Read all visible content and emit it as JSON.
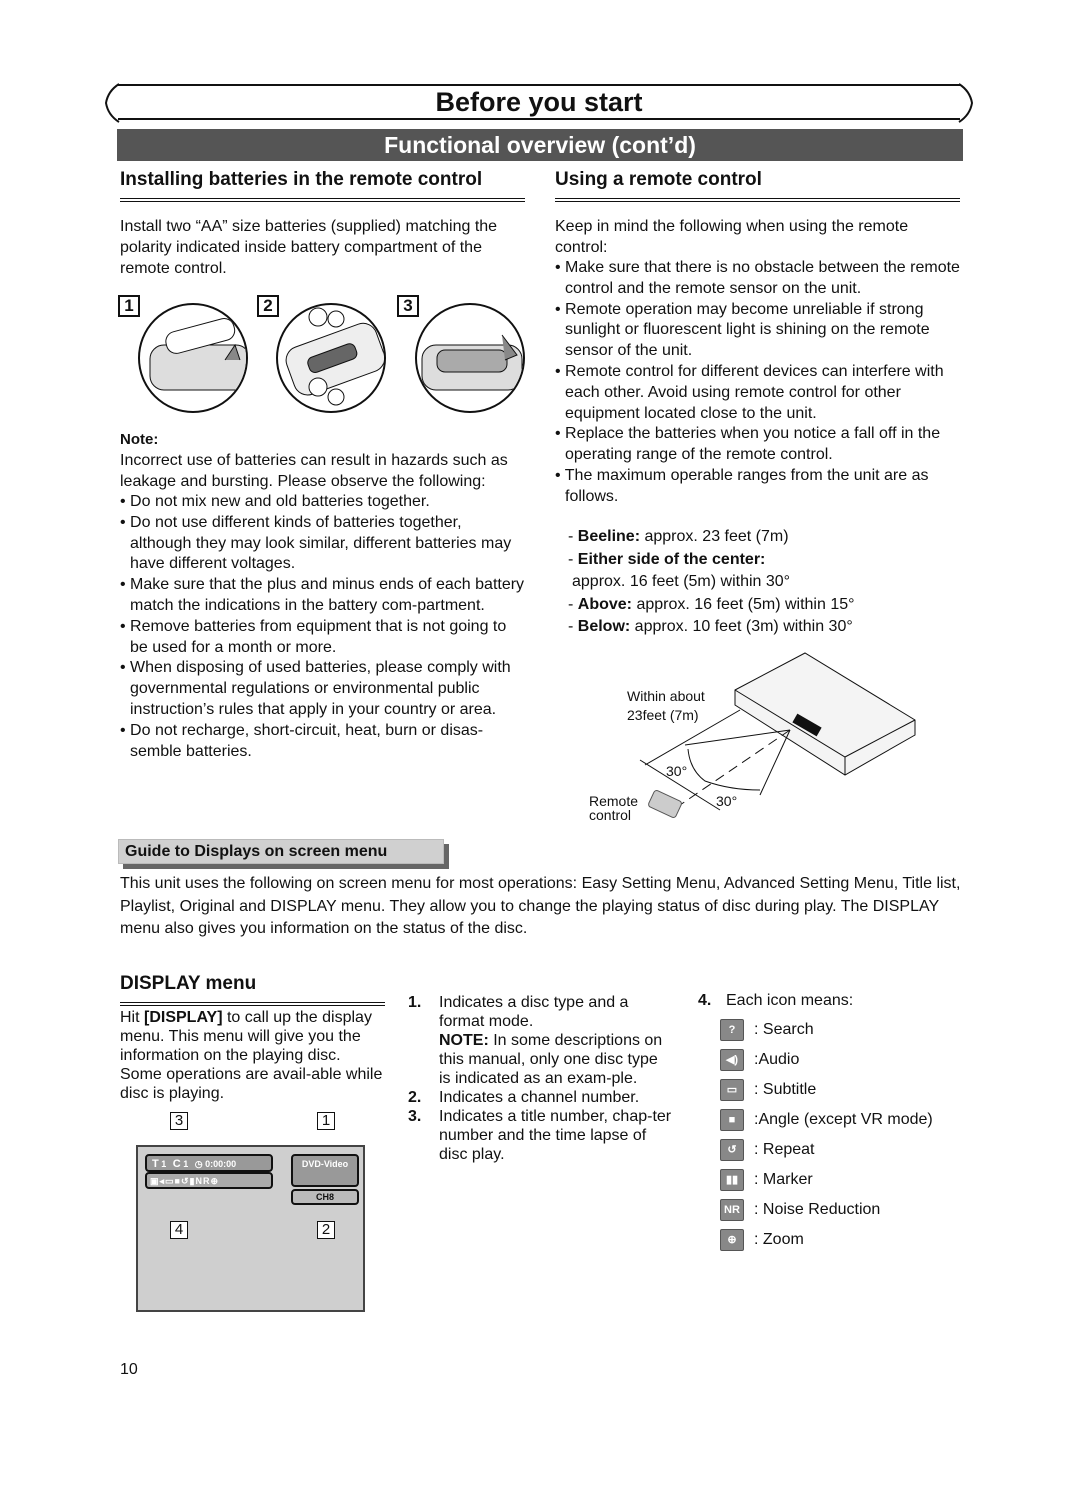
{
  "header": {
    "title": "Before you start",
    "subtitle": "Functional overview (cont’d)"
  },
  "batteries": {
    "heading": "Installing batteries in the remote control",
    "intro": "Install two “AA” size batteries (supplied) matching the polarity indicated inside battery compartment of the remote control.",
    "steps": [
      "1",
      "2",
      "3"
    ],
    "note_label": "Note:",
    "note_text": "Incorrect use of batteries can result in hazards such as leakage and bursting. Please observe the following:",
    "bullets": [
      "Do not mix new and old batteries together.",
      "Do not use different kinds of batteries together, although they may look similar, different batteries may have different voltages.",
      "Make sure that the plus and minus ends of each battery match the indications in the battery com-partment.",
      "Remove batteries from equipment that is not going to be used for a month or more.",
      "When disposing of used batteries, please comply with governmental regulations or environmental public instruction’s rules that apply in your country or area.",
      "Do not recharge, short-circuit, heat, burn or disas-semble batteries."
    ]
  },
  "remote": {
    "heading": "Using a remote control",
    "intro": "Keep in mind the following when using the remote control:",
    "bullets": [
      "Make sure that there is no obstacle between the remote control and the remote sensor on the unit.",
      "Remote operation may become unreliable if strong sunlight or fluorescent light is shining on the remote sensor of the unit.",
      "Remote control for different devices can interfere with each other.  Avoid using remote control for other equipment located close to the unit.",
      "Replace the batteries when you notice a fall off in the operating range of the remote control.",
      "The maximum operable ranges from the unit are as follows."
    ],
    "ranges": [
      {
        "label": "Beeline:",
        "value": " approx. 23 feet (7m)"
      },
      {
        "label": "Either side of the center:",
        "value": ""
      },
      {
        "label": "",
        "value": "approx. 16 feet (5m) within 30°"
      },
      {
        "label": "Above:",
        "value": "  approx. 16 feet (5m) within 15°"
      },
      {
        "label": "Below:",
        "value": "  approx. 10 feet (3m) within 30°"
      }
    ],
    "diagram": {
      "within_line1": "Within about",
      "within_line2": "23feet (7m)",
      "angle1": "30°",
      "angle2": "30°",
      "remote_line1": "Remote",
      "remote_line2": "control"
    }
  },
  "guide": {
    "heading": "Guide to Displays on screen menu",
    "text": "This unit uses the following on screen menu for most operations: Easy Setting Menu, Advanced Setting Menu, Title list, Playlist, Original and DISPLAY menu. They allow you to change the playing status of disc during play. The DISPLAY menu also gives you information on the status of the disc."
  },
  "display_menu": {
    "heading": "DISPLAY menu",
    "text_pre": "Hit ",
    "text_bold": "[DISPLAY]",
    "text_post": " to call up the display menu. This menu will give you the information on the playing disc. Some operations are avail-able while disc is playing.",
    "osd": {
      "t": "T",
      "title_num": "1",
      "c": "C",
      "chapter_num": "1",
      "time": "0:00:00",
      "disc": "DVD-Video",
      "channel": "CH8",
      "callouts": [
        "3",
        "1",
        "4",
        "2"
      ]
    },
    "numbered": [
      {
        "n": "1.",
        "text": "Indicates a disc type and a format mode."
      },
      {
        "n": "",
        "bold": "NOTE:",
        "text": " In some descriptions on this manual, only one disc type is indicated as an exam-ple."
      },
      {
        "n": "2.",
        "text": "Indicates a channel number."
      },
      {
        "n": "3.",
        "text": "Indicates a title number, chap-ter number and the time lapse of disc play."
      }
    ],
    "icons_intro_n": "4.",
    "icons_intro": "Each icon means:",
    "icons": [
      {
        "icon": "search-icon",
        "glyph": "?",
        "label": ": Search"
      },
      {
        "icon": "audio-icon",
        "glyph": "◀)",
        "label": ":Audio"
      },
      {
        "icon": "subtitle-icon",
        "glyph": "▭",
        "label": ": Subtitle"
      },
      {
        "icon": "angle-icon",
        "glyph": "■",
        "label": ":Angle (except VR mode)"
      },
      {
        "icon": "repeat-icon",
        "glyph": "↺",
        "label": ": Repeat"
      },
      {
        "icon": "marker-icon",
        "glyph": "▮▮",
        "label": ": Marker"
      },
      {
        "icon": "noise-reduction-icon",
        "glyph": "NR",
        "label": ": Noise Reduction"
      },
      {
        "icon": "zoom-icon",
        "glyph": "⊕",
        "label": ": Zoom"
      }
    ]
  },
  "page_number": "10"
}
